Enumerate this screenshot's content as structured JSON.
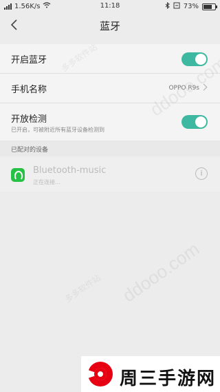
{
  "status": {
    "speed": "1.56K/s",
    "time": "11:18",
    "battery": "73%",
    "battery_level": 0.73
  },
  "header": {
    "title": "蓝牙",
    "back_icon": "chevron-left-icon"
  },
  "settings": {
    "bluetooth_label": "开启蓝牙",
    "device_name_label": "手机名称",
    "device_name_value": "OPPO R9s",
    "discovery_label": "开放检测",
    "discovery_sub": "已开启，可被附近所有蓝牙设备检测到"
  },
  "paired": {
    "header": "已配对的设备",
    "devices": [
      {
        "name": "Bluetooth-music",
        "status": "正在连接..."
      }
    ]
  },
  "colors": {
    "accent": "#3fb8a1",
    "device_icon": "#27c146",
    "logo_red": "#e60012"
  },
  "footer": {
    "logo_text": "周三手游网"
  }
}
